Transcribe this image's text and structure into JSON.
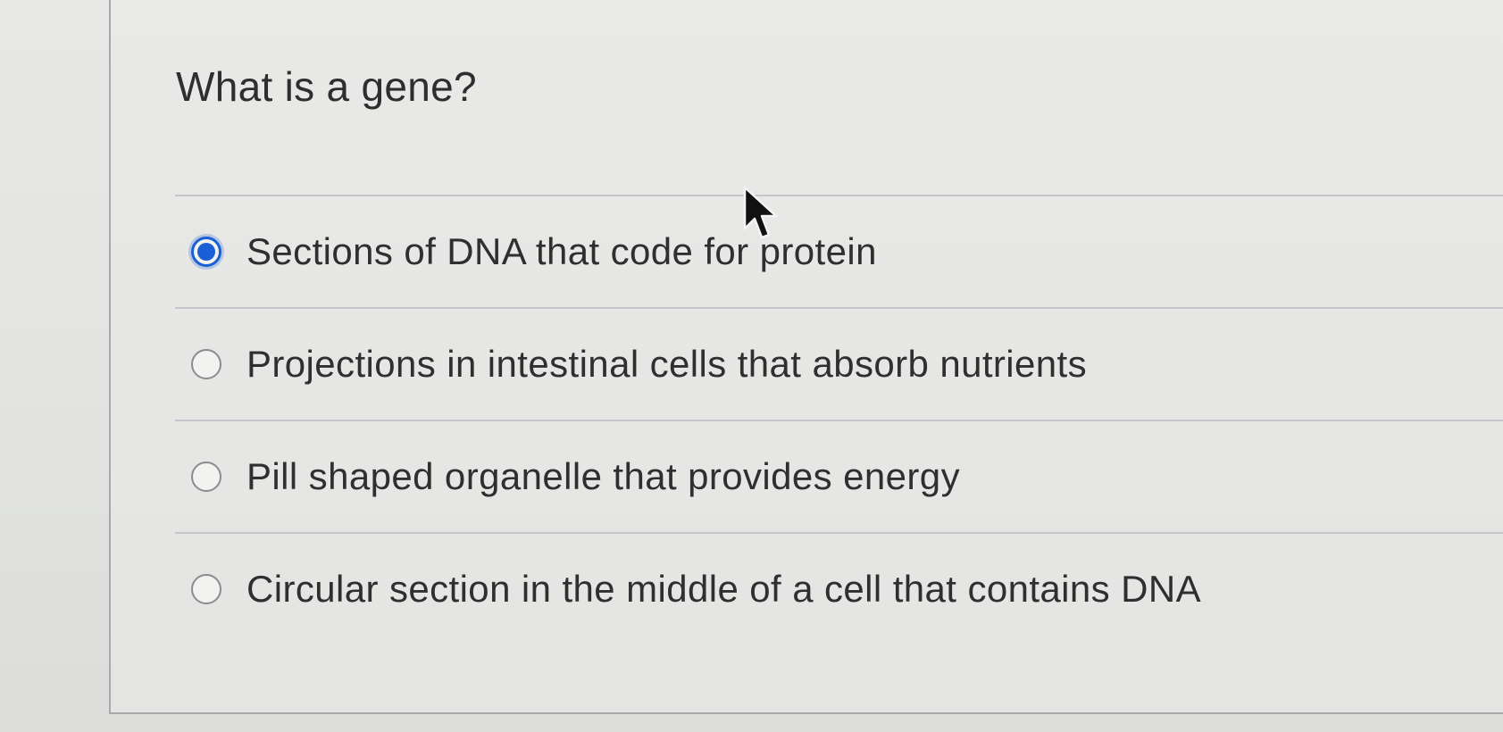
{
  "quiz": {
    "question": "What is a gene?",
    "selected_index": 0,
    "options": [
      {
        "label": "Sections of DNA that code for protein",
        "selected": true
      },
      {
        "label": "Projections in intestinal cells that absorb nutrients",
        "selected": false
      },
      {
        "label": "Pill shaped organelle that provides energy",
        "selected": false
      },
      {
        "label": "Circular section in the middle of a cell that contains DNA",
        "selected": false
      }
    ]
  },
  "colors": {
    "accent": "#1a5fd6",
    "text": "#2f2f2f",
    "divider": "#c3c7cc",
    "background": "#e6e6e4"
  },
  "icons": {
    "cursor": "mouse-pointer-icon",
    "radio_selected": "radio-checked-icon",
    "radio_unselected": "radio-unchecked-icon"
  }
}
